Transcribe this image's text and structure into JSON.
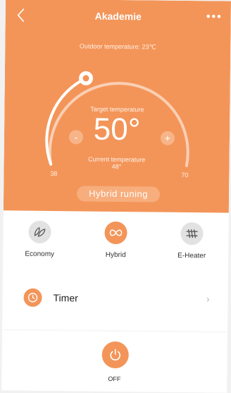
{
  "header": {
    "title": "Akademie",
    "back_icon": "chevron-left-icon",
    "more_label": "•••"
  },
  "climate": {
    "outdoor_text": "Outdoor temperature: 23℃",
    "target_label": "Target temperature",
    "target_value": "50°",
    "current_label": "Current temperature",
    "current_value": "48°",
    "minus_label": "-",
    "plus_label": "+",
    "min": "38",
    "max": "70",
    "status": "Hybrid  runing"
  },
  "modes": [
    {
      "label": "Economy",
      "icon": "leaf-icon",
      "active": false
    },
    {
      "label": "Hybrid",
      "icon": "infinity-icon",
      "active": true
    },
    {
      "label": "E-Heater",
      "icon": "heater-icon",
      "active": false
    }
  ],
  "timer": {
    "label": "Timer",
    "icon": "clock-icon"
  },
  "power": {
    "label": "OFF",
    "icon": "power-icon"
  },
  "colors": {
    "accent": "#f39559",
    "background": "#ffffff"
  }
}
